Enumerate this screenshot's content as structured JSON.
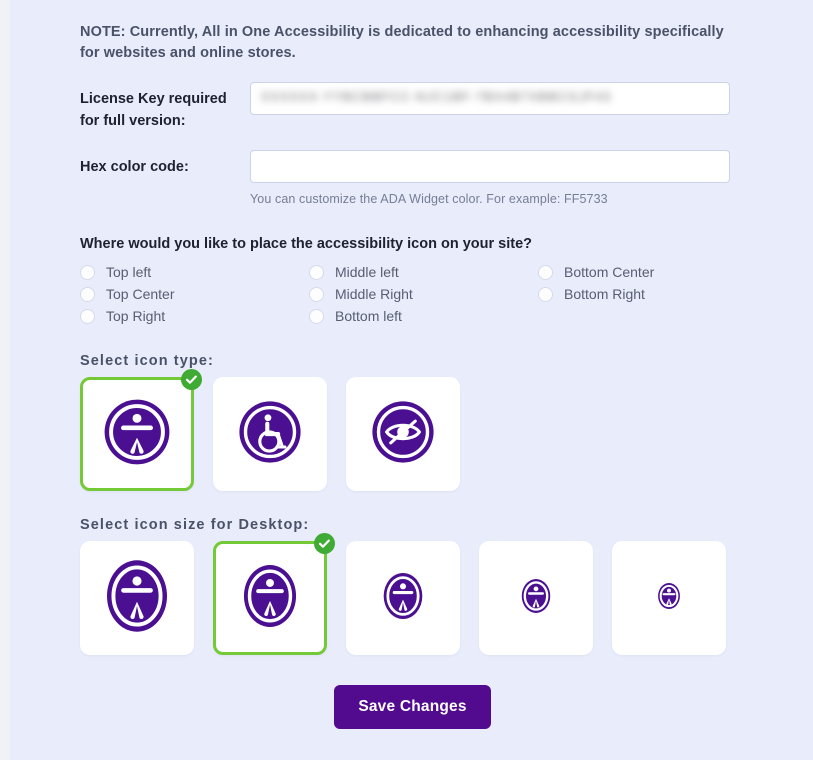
{
  "note": "NOTE: Currently, All in One Accessibility is dedicated to enhancing accessibility specifically for websites and online stores.",
  "license": {
    "label": "License Key required for full version:",
    "value": "XXXXXX-YYBCBBFCC-NJC1BF-7BX4B7XBBCGJF43",
    "redacted": true,
    "placeholder": ""
  },
  "hex": {
    "label": "Hex color code:",
    "value": "",
    "placeholder": "",
    "hint": "You can customize the ADA Widget color. For example: FF5733"
  },
  "placement": {
    "question": "Where would you like to place the accessibility icon on your site?",
    "options": [
      {
        "label": "Top left",
        "selected": false
      },
      {
        "label": "Top Center",
        "selected": false
      },
      {
        "label": "Top Right",
        "selected": false
      },
      {
        "label": "Middle left",
        "selected": false
      },
      {
        "label": "Middle Right",
        "selected": false
      },
      {
        "label": "Bottom left",
        "selected": false
      },
      {
        "label": "Bottom Center",
        "selected": false
      },
      {
        "label": "Bottom Right",
        "selected": false
      }
    ]
  },
  "icon_type": {
    "heading": "Select  icon  type:",
    "options": [
      {
        "icon": "accessibility-person-icon",
        "selected": true
      },
      {
        "icon": "wheelchair-icon",
        "selected": false
      },
      {
        "icon": "eye-slash-icon",
        "selected": false
      }
    ]
  },
  "icon_size": {
    "heading": "Select  icon  size  for  Desktop:",
    "options": [
      {
        "icon": "accessibility-person-icon",
        "size": 72,
        "selected": false
      },
      {
        "icon": "accessibility-person-icon",
        "size": 62,
        "selected": true
      },
      {
        "icon": "accessibility-person-icon",
        "size": 46,
        "selected": false
      },
      {
        "icon": "accessibility-person-icon",
        "size": 34,
        "selected": false
      },
      {
        "icon": "accessibility-person-icon",
        "size": 26,
        "selected": false
      }
    ]
  },
  "save": {
    "label": "Save Changes"
  },
  "colors": {
    "background": "#e8ecfb",
    "purple": "#520b8e",
    "icon_purple": "#4a1091",
    "selected_green": "#74c937",
    "check_green": "#3faa34"
  }
}
